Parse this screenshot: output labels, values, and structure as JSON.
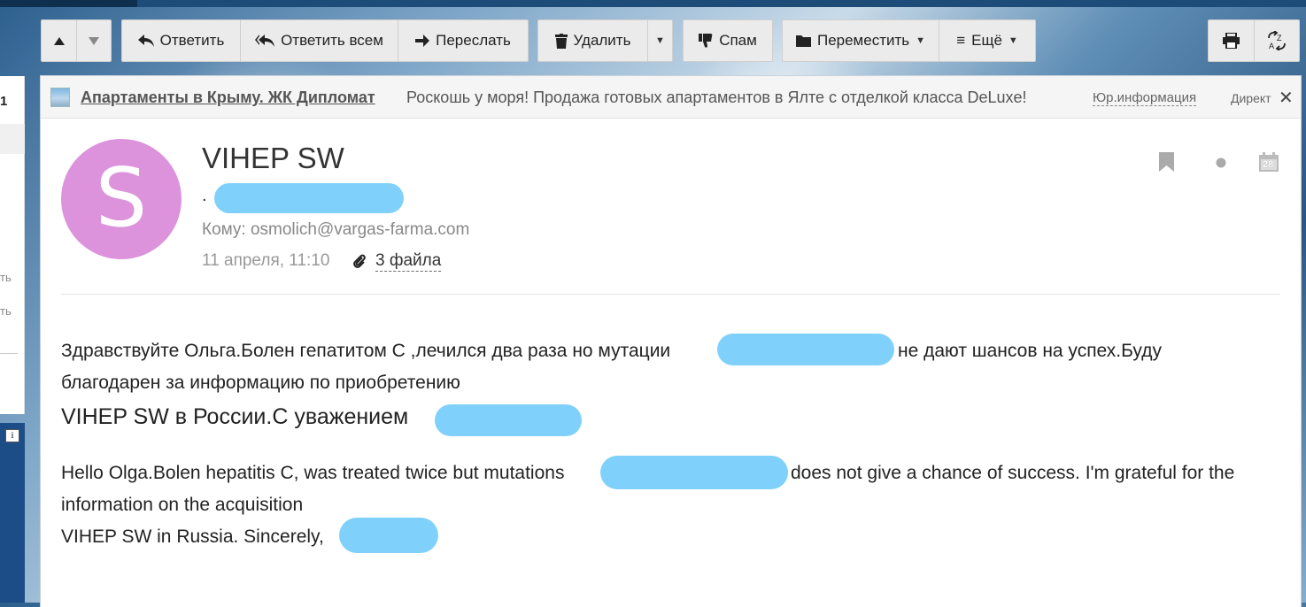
{
  "toolbar": {
    "reply": "Ответить",
    "reply_all": "Ответить всем",
    "forward": "Переслать",
    "delete": "Удалить",
    "spam": "Спам",
    "move": "Переместить",
    "more": "Ещё"
  },
  "sidebar": {
    "count": "1",
    "frag1": "ть",
    "frag2": "ть"
  },
  "ad": {
    "title": "Апартаменты в Крыму. ЖК Дипломат",
    "text": "Роскошь у моря! Продажа готовых апартаментов в Ялте с отделкой класса DeLuxe!",
    "legal": "Юр.информация",
    "direct": "Директ"
  },
  "message": {
    "avatar_letter": "S",
    "sender_name": "VIHEP SW",
    "sender_prefix": ".",
    "to": "Кому: osmolich@vargas-farma.com",
    "date": "11 апреля, 11:10",
    "attachments": "3 файла",
    "calendar_day": "28"
  },
  "body": {
    "ru_line1a": "Здравствуйте Ольга.Болен гепатитом С ,лечился  два раза но мутации",
    "ru_line1b": "не дают шансов на успех.Буду",
    "ru_line2": "благодарен за информацию по приобретению",
    "ru_line3": "VIHEP SW в России.С уважением",
    "en_line1a": "Hello Olga.Bolen hepatitis C, was treated twice but mutations",
    "en_line1b": "does not give a chance of success. I'm grateful for the",
    "en_line2": "information on the acquisition",
    "en_line3": "VIHEP SW in Russia. Sincerely,"
  },
  "colors": {
    "avatar": "#dc93dc",
    "redaction": "#7fd1fb",
    "toolbar_bg": "#ebebeb"
  }
}
